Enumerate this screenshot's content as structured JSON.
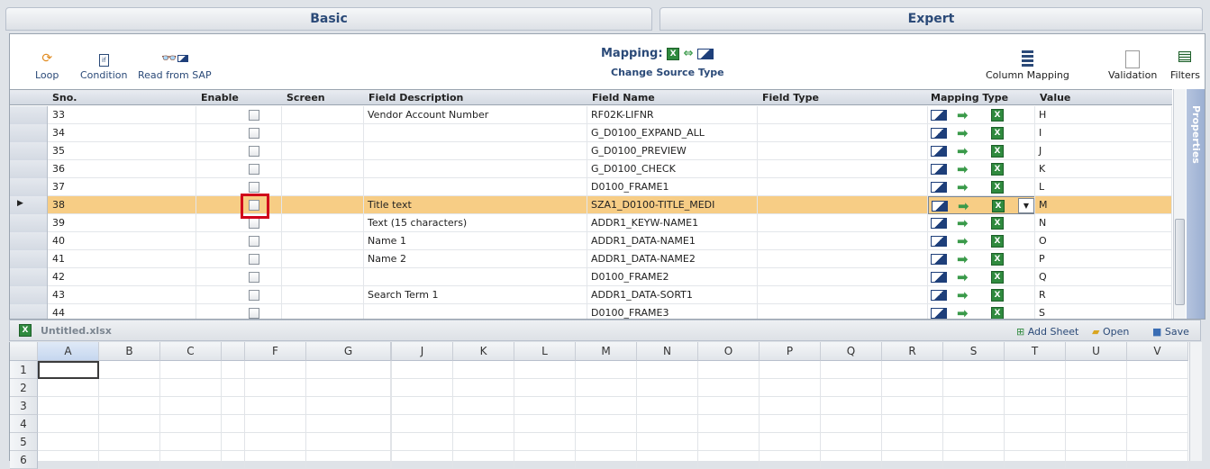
{
  "tabs": {
    "basic": "Basic",
    "expert": "Expert"
  },
  "toolbar": {
    "loop": "Loop",
    "condition": "Condition",
    "read_from_sap": "Read from SAP",
    "mapping_label": "Mapping:",
    "change_source_type": "Change Source Type",
    "column_mapping": "Column Mapping",
    "validation": "Validation",
    "filters": "Filters"
  },
  "grid": {
    "headers": {
      "sno": "Sno.",
      "enable": "Enable",
      "screen": "Screen",
      "field_description": "Field Description",
      "field_name": "Field Name",
      "field_type": "Field Type",
      "mapping_type": "Mapping Type",
      "value": "Value"
    },
    "rows": [
      {
        "sno": "33",
        "desc": "Vendor Account Number",
        "name": "RF02K-LIFNR",
        "type": "",
        "value": "H"
      },
      {
        "sno": "34",
        "desc": "",
        "name": "G_D0100_EXPAND_ALL",
        "type": "",
        "value": "I"
      },
      {
        "sno": "35",
        "desc": "",
        "name": "G_D0100_PREVIEW",
        "type": "",
        "value": "J"
      },
      {
        "sno": "36",
        "desc": "",
        "name": "G_D0100_CHECK",
        "type": "",
        "value": "K"
      },
      {
        "sno": "37",
        "desc": "",
        "name": "D0100_FRAME1",
        "type": "",
        "value": "L"
      },
      {
        "sno": "38",
        "desc": "Title text",
        "name": "SZA1_D0100-TITLE_MEDI",
        "type": "",
        "value": "M"
      },
      {
        "sno": "39",
        "desc": "Text (15 characters)",
        "name": "ADDR1_KEYW-NAME1",
        "type": "",
        "value": "N"
      },
      {
        "sno": "40",
        "desc": "Name 1",
        "name": "ADDR1_DATA-NAME1",
        "type": "",
        "value": "O"
      },
      {
        "sno": "41",
        "desc": "Name 2",
        "name": "ADDR1_DATA-NAME2",
        "type": "",
        "value": "P"
      },
      {
        "sno": "42",
        "desc": "",
        "name": "D0100_FRAME2",
        "type": "",
        "value": "Q"
      },
      {
        "sno": "43",
        "desc": "Search Term 1",
        "name": "ADDR1_DATA-SORT1",
        "type": "",
        "value": "R"
      },
      {
        "sno": "44",
        "desc": "",
        "name": "D0100_FRAME3",
        "type": "",
        "value": "S"
      }
    ],
    "selected_row_index": 5
  },
  "properties_label": "Properties",
  "sheet": {
    "filename": "Untitled.xlsx",
    "add_sheet": "Add Sheet",
    "open": "Open",
    "save": "Save",
    "columns": [
      "A",
      "B",
      "C",
      "",
      "F",
      "G",
      "",
      "J",
      "K",
      "L",
      "M",
      "N",
      "O",
      "P",
      "Q",
      "R",
      "S",
      "T",
      "U",
      "V"
    ],
    "rows": [
      "1",
      "2",
      "3",
      "4",
      "5",
      "6"
    ]
  },
  "colors": {
    "accent": "#2b4a78",
    "selected_row": "#f7cd85",
    "highlight": "#d0021b"
  }
}
